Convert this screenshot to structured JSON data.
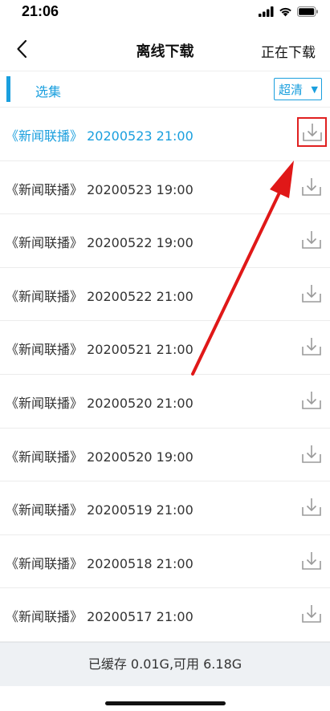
{
  "status_bar": {
    "time": "21:06"
  },
  "nav": {
    "title": "离线下载",
    "right_action": "正在下载"
  },
  "select_row": {
    "label": "选集",
    "quality": "超清"
  },
  "episodes": [
    {
      "name": "《新闻联播》",
      "datetime": "20200523 21:00",
      "active": true
    },
    {
      "name": "《新闻联播》",
      "datetime": "20200523 19:00"
    },
    {
      "name": "《新闻联播》",
      "datetime": "20200522 19:00"
    },
    {
      "name": "《新闻联播》",
      "datetime": "20200522 21:00"
    },
    {
      "name": "《新闻联播》",
      "datetime": "20200521 21:00"
    },
    {
      "name": "《新闻联播》",
      "datetime": "20200520 21:00"
    },
    {
      "name": "《新闻联播》",
      "datetime": "20200520 19:00"
    },
    {
      "name": "《新闻联播》",
      "datetime": "20200519 21:00"
    },
    {
      "name": "《新闻联播》",
      "datetime": "20200518 21:00"
    },
    {
      "name": "《新闻联播》",
      "datetime": "20200517 21:00"
    }
  ],
  "footer": {
    "storage_text": "已缓存 0.01G,可用 6.18G"
  },
  "colors": {
    "accent": "#1a9fde",
    "highlight": "#e02020",
    "footer_bg": "#eef1f4"
  },
  "icons": {
    "back": "chevron-left-icon",
    "download": "download-icon",
    "caret": "caret-down-icon"
  }
}
